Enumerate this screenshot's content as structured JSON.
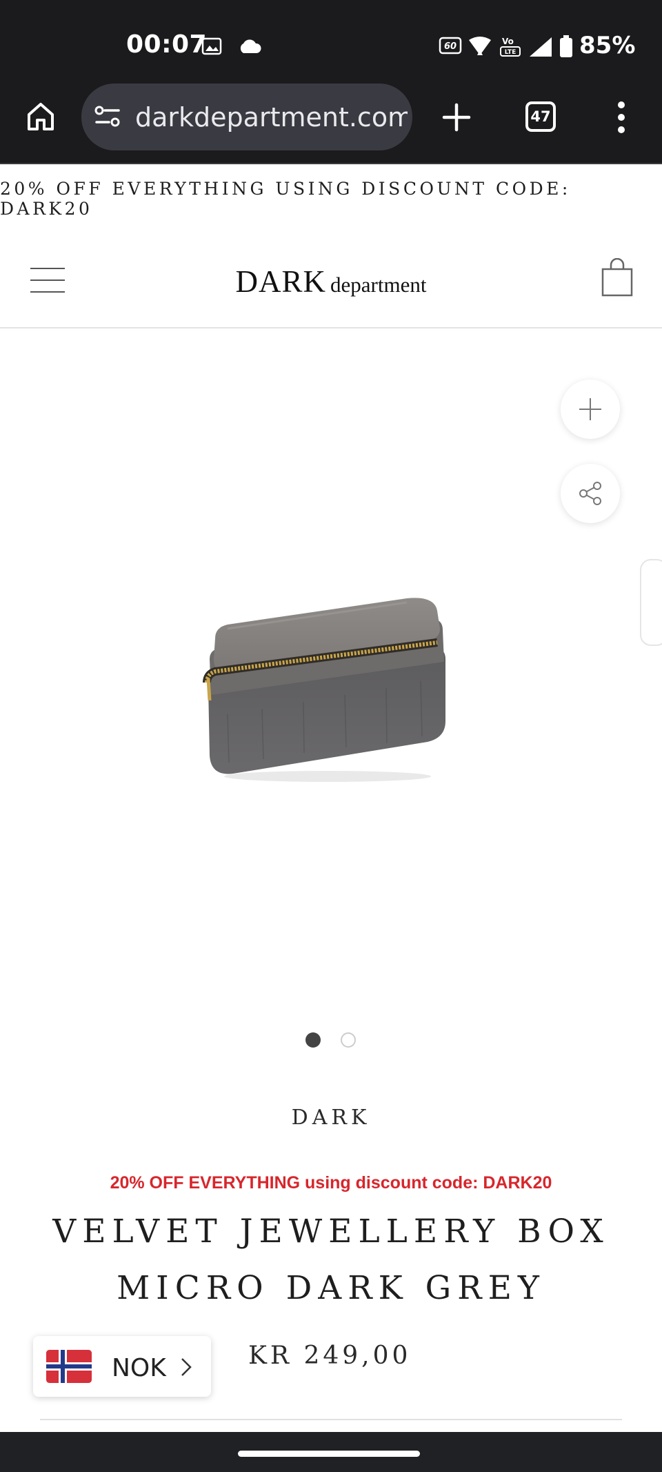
{
  "status_bar": {
    "time": "00:07",
    "battery": "85%",
    "icons": [
      "gallery-icon",
      "cloud-icon",
      "refresh-rate-icon",
      "wifi-icon",
      "volte-icon",
      "signal-icon",
      "battery-icon"
    ]
  },
  "browser": {
    "url": "darkdepartment.com/",
    "tab_count": "47",
    "icons": [
      "home-icon",
      "site-settings-icon",
      "new-tab-icon",
      "menu-dots-icon"
    ]
  },
  "promo_banner": {
    "text": "20% OFF EVERYTHING USING DISCOUNT CODE: DARK20"
  },
  "header": {
    "logo_main": "DARK",
    "logo_sub": "department",
    "icons": [
      "hamburger-menu-icon",
      "shopping-bag-icon"
    ]
  },
  "gallery": {
    "image_count": 2,
    "active_index": 0,
    "icons": [
      "zoom-plus-icon",
      "share-icon"
    ]
  },
  "product": {
    "brand": "DARK",
    "discount_note": "20% OFF EVERYTHING using discount code: DARK20",
    "title_line1": "VELVET JEWELLERY BOX",
    "title_line2": "MICRO DARK GREY",
    "price": "KR 249,00"
  },
  "currency": {
    "code": "NOK",
    "flag": "norway-flag-icon"
  },
  "colors": {
    "system_bar": "#1b1b1d",
    "url_pill": "#3a3b42",
    "promo_red": "#d7262c",
    "text_dark": "#1e1e1e"
  }
}
